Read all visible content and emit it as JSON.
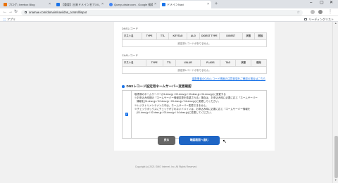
{
  "browser": {
    "tabs": [
      {
        "title": "ブログ | beebox Blog",
        "favicon_color": "#e8710a",
        "active": false
      },
      {
        "title": "【重要】出来ドメイン名でXX、お問い合わせ",
        "favicon_color": "#1a73e8",
        "active": false
      },
      {
        "title": "Query-ofake.com - Google 検索",
        "favicon_color": "#4285f4",
        "active": false
      },
      {
        "title": "ドメインNavi",
        "favicon_color": "#1a73e8",
        "active": true
      }
    ],
    "new_tab_glyph": "+",
    "url": "onamae.com/domain/navi/dns_controll/input",
    "apps_label": "アプリ",
    "reading_list_label": "リーディングリスト"
  },
  "dns_section": {
    "label": "DNSレコード",
    "columns": [
      "ホスト名",
      "TYPE",
      "TTL",
      "KEYTAG",
      "ALG",
      "DIGEST TYPE",
      "DIGEST",
      "状態",
      "削除"
    ],
    "empty_message": "設定済レコードがありません。"
  },
  "caa_section": {
    "label": "CAAレコード",
    "columns": [
      "ホスト名",
      "TYPE",
      "TTL",
      "VALUE",
      "FLAGS",
      "TAG",
      "状態",
      "削除"
    ],
    "empty_message": "設定済レコードがありません。",
    "link_text": "複数業者のCAAレコード情報の注意事項をご確認の場合はこちら"
  },
  "nameserver_section": {
    "title": "DNSレコード設定用ネームサーバー変更確認",
    "checked": true,
    "check_glyph": "✓",
    "lines": [
      "取得済のネームサーバー(01.dnsv.jp / 02.dnsv.jp / 03.dnsv.jp / 04.dnsv.jp)に変更する",
      "※お申込み時期の「ネームサーバー情報変更を希望される」場合は、お申込み時に必要に応じ「ネームサーバー",
      "情報を(01.dnsv.jp / 02.dnsv.jp / 03.dnsv.jp / 04.dnsv.jp)に変更してください。",
      "※レジストリメンテナンス中は、ネームサーバー変更できません。",
      "※チェックボックスにチェックがされないドメインは、お申込み時に必要に応じ「ネームサーバー情報を",
      "(01.dnsv.jp / 02.dnsv.jp / 03.dnsv.jp / 04.dnsv.jp)に変更してください。"
    ]
  },
  "buttons": {
    "back": "戻る",
    "next": "確認画面へ進む"
  },
  "footer": {
    "copyright": "Copyright (c) 2021 GMO Internet, Inc. All Rights Reserved."
  }
}
